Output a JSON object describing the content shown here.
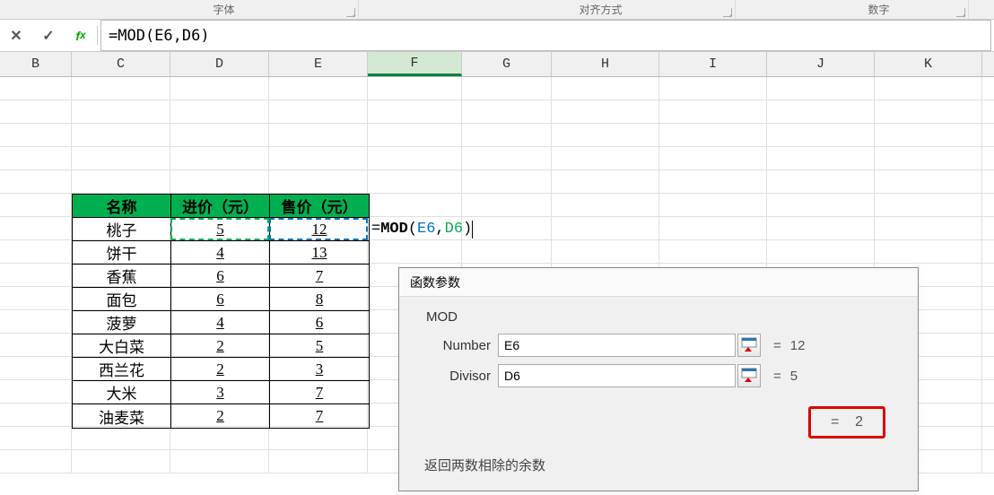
{
  "ribbon": {
    "font_label": "字体",
    "align_label": "对齐方式",
    "number_label": "数字"
  },
  "formula_bar": {
    "formula": "=MOD(E6,D6)"
  },
  "columns": [
    "B",
    "C",
    "D",
    "E",
    "F",
    "G",
    "H",
    "I",
    "J",
    "K"
  ],
  "active_col_index": 4,
  "table": {
    "headers": [
      "名称",
      "进价（元）",
      "售价（元）"
    ],
    "rows": [
      [
        "桃子",
        "5",
        "12"
      ],
      [
        "饼干",
        "4",
        "13"
      ],
      [
        "香蕉",
        "6",
        "7"
      ],
      [
        "面包",
        "6",
        "8"
      ],
      [
        "菠萝",
        "4",
        "6"
      ],
      [
        "大白菜",
        "2",
        "5"
      ],
      [
        "西兰花",
        "2",
        "3"
      ],
      [
        "大米",
        "3",
        "7"
      ],
      [
        "油麦菜",
        "2",
        "7"
      ]
    ]
  },
  "active_cell": {
    "prefix": "=",
    "func": "MOD",
    "open": "(",
    "arg1": "E6",
    "comma": ",",
    "arg2": "D6",
    "close": ")"
  },
  "dialog": {
    "title": "函数参数",
    "func_name": "MOD",
    "args": [
      {
        "label": "Number",
        "value": "E6",
        "result": "12"
      },
      {
        "label": "Divisor",
        "value": "D6",
        "result": "5"
      }
    ],
    "eq": "=",
    "final_result": "2",
    "description": "返回两数相除的余数"
  }
}
